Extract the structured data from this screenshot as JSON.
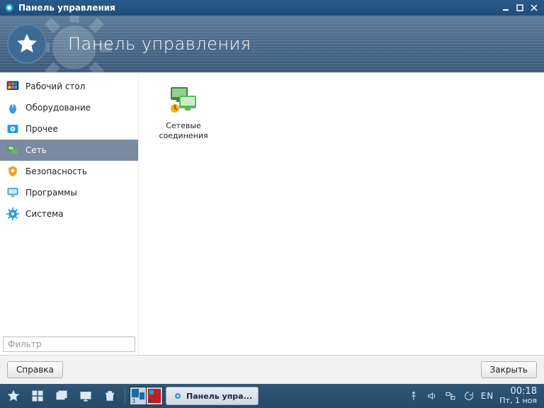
{
  "window": {
    "title": "Панель управления",
    "banner_title": "Панель управления"
  },
  "sidebar": {
    "filter_placeholder": "Фильтр",
    "items": [
      {
        "label": "Рабочий стол",
        "icon": "desktop-grid-icon"
      },
      {
        "label": "Оборудование",
        "icon": "mouse-icon"
      },
      {
        "label": "Прочее",
        "icon": "gear-box-icon"
      },
      {
        "label": "Сеть",
        "icon": "network-icon"
      },
      {
        "label": "Безопасность",
        "icon": "shield-icon"
      },
      {
        "label": "Программы",
        "icon": "monitor-icon"
      },
      {
        "label": "Система",
        "icon": "gear-icon"
      }
    ],
    "selected_index": 3
  },
  "content": {
    "items": [
      {
        "label_line1": "Сетевые",
        "label_line2": "соединения",
        "icon": "network-connections-icon"
      }
    ]
  },
  "footer": {
    "help_label": "Справка",
    "close_label": "Закрыть"
  },
  "taskbar": {
    "active_task": "Панель упра...",
    "pager_labels": [
      "3",
      "4"
    ],
    "lang": "EN",
    "clock_time": "00:18",
    "clock_date": "Пт, 1 ноя"
  }
}
